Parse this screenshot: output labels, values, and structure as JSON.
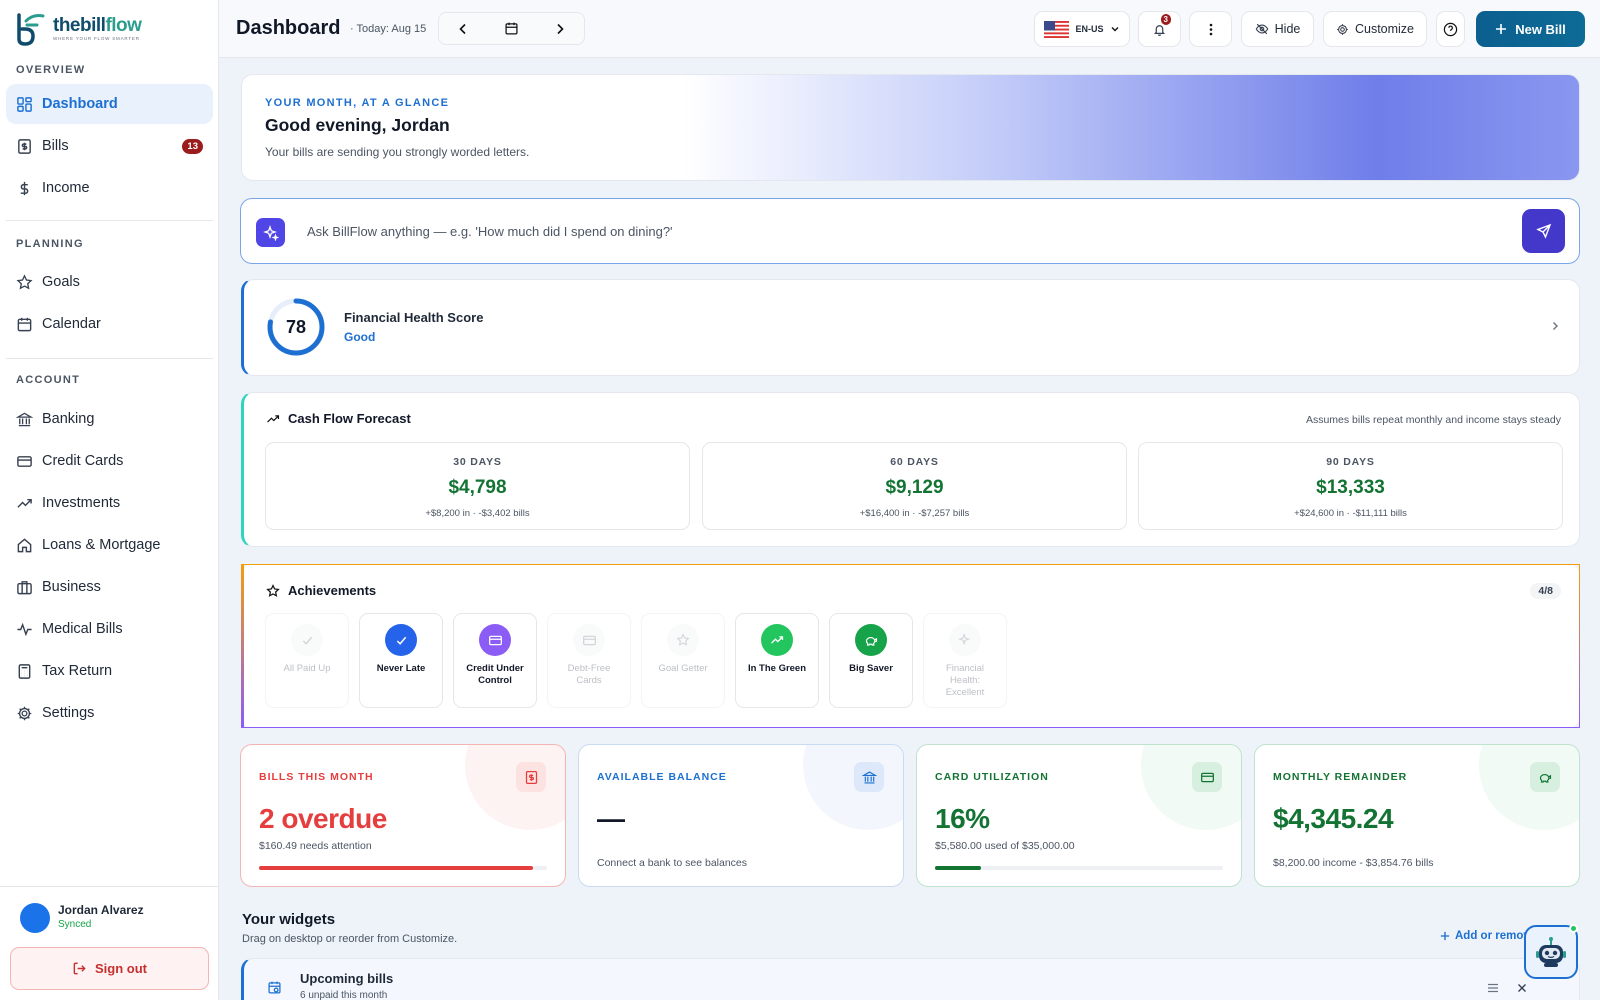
{
  "brand": {
    "name_a": "thebill",
    "name_b": "flow",
    "tagline": "WHERE YOUR FLOW SMARTER"
  },
  "sidebar": {
    "overview_label": "OVERVIEW",
    "planning_label": "PLANNING",
    "account_label": "ACCOUNT",
    "items": [
      {
        "label": "Dashboard",
        "icon": "dashboard-icon",
        "active": true
      },
      {
        "label": "Bills",
        "icon": "bill-icon",
        "badge": "13"
      },
      {
        "label": "Income",
        "icon": "dollar-icon"
      },
      {
        "label": "Goals",
        "icon": "star-icon"
      },
      {
        "label": "Calendar",
        "icon": "calendar-icon"
      },
      {
        "label": "Banking",
        "icon": "bank-icon"
      },
      {
        "label": "Credit Cards",
        "icon": "credit-card-icon"
      },
      {
        "label": "Investments",
        "icon": "trend-up-icon"
      },
      {
        "label": "Loans & Mortgage",
        "icon": "home-icon"
      },
      {
        "label": "Business",
        "icon": "briefcase-icon"
      },
      {
        "label": "Medical Bills",
        "icon": "pulse-icon"
      },
      {
        "label": "Tax Return",
        "icon": "calculator-icon"
      },
      {
        "label": "Settings",
        "icon": "gear-icon"
      }
    ],
    "user": {
      "name": "Jordan Alvarez",
      "status": "Synced"
    },
    "signout_label": "Sign out"
  },
  "header": {
    "title": "Dashboard",
    "today": "· Today: Aug 15",
    "locale": "EN-US",
    "notifications": "3",
    "hide_label": "Hide",
    "customize_label": "Customize",
    "new_bill_label": "New Bill"
  },
  "hero": {
    "eyebrow": "YOUR MONTH, AT A GLANCE",
    "title": "Good evening, Jordan",
    "subtitle": "Your bills are sending you strongly worded letters."
  },
  "ask": {
    "placeholder": "Ask BillFlow anything — e.g. 'How much did I spend on dining?'"
  },
  "health": {
    "score": "78",
    "score_value": 78,
    "title": "Financial Health Score",
    "grade": "Good"
  },
  "cashflow": {
    "title": "Cash Flow Forecast",
    "note": "Assumes bills repeat monthly and income stays steady",
    "periods": [
      {
        "label": "30 DAYS",
        "value": "$4,798",
        "detail": "+$8,200 in · -$3,402 bills"
      },
      {
        "label": "60 DAYS",
        "value": "$9,129",
        "detail": "+$16,400 in · -$7,257 bills"
      },
      {
        "label": "90 DAYS",
        "value": "$13,333",
        "detail": "+$24,600 in · -$11,111 bills"
      }
    ]
  },
  "achievements": {
    "title": "Achievements",
    "count": "4/8",
    "items": [
      {
        "name": "All Paid Up",
        "unlocked": false,
        "color": "#9ca3af"
      },
      {
        "name": "Never Late",
        "unlocked": true,
        "color": "#2563eb"
      },
      {
        "name": "Credit Under Control",
        "unlocked": true,
        "color": "#8b5cf6"
      },
      {
        "name": "Debt-Free Cards",
        "unlocked": false,
        "color": "#9ca3af"
      },
      {
        "name": "Goal Getter",
        "unlocked": false,
        "color": "#9ca3af"
      },
      {
        "name": "In The Green",
        "unlocked": true,
        "color": "#22c55e"
      },
      {
        "name": "Big Saver",
        "unlocked": true,
        "color": "#16a34a"
      },
      {
        "name": "Financial Health: Excellent",
        "unlocked": false,
        "color": "#9ca3af"
      }
    ]
  },
  "stats": [
    {
      "label": "BILLS THIS MONTH",
      "value": "2 overdue",
      "sub": "$160.49 needs attention",
      "color": "#e53e3e",
      "progress": 0.95
    },
    {
      "label": "AVAILABLE BALANCE",
      "value": "—",
      "sub": "Connect a bank to see balances",
      "color": "#1d6fd1"
    },
    {
      "label": "CARD UTILIZATION",
      "value": "16%",
      "sub": "$5,580.00 used of $35,000.00",
      "color": "#137333",
      "progress": 0.16
    },
    {
      "label": "MONTHLY REMAINDER",
      "value": "$4,345.24",
      "sub": "$8,200.00 income - $3,854.76 bills",
      "color": "#137333"
    }
  ],
  "widgets": {
    "title": "Your widgets",
    "subtitle": "Drag on desktop or reorder from Customize.",
    "add_label": "Add or remove",
    "upcoming_title": "Upcoming bills",
    "upcoming_sub": "6 unpaid this month"
  }
}
